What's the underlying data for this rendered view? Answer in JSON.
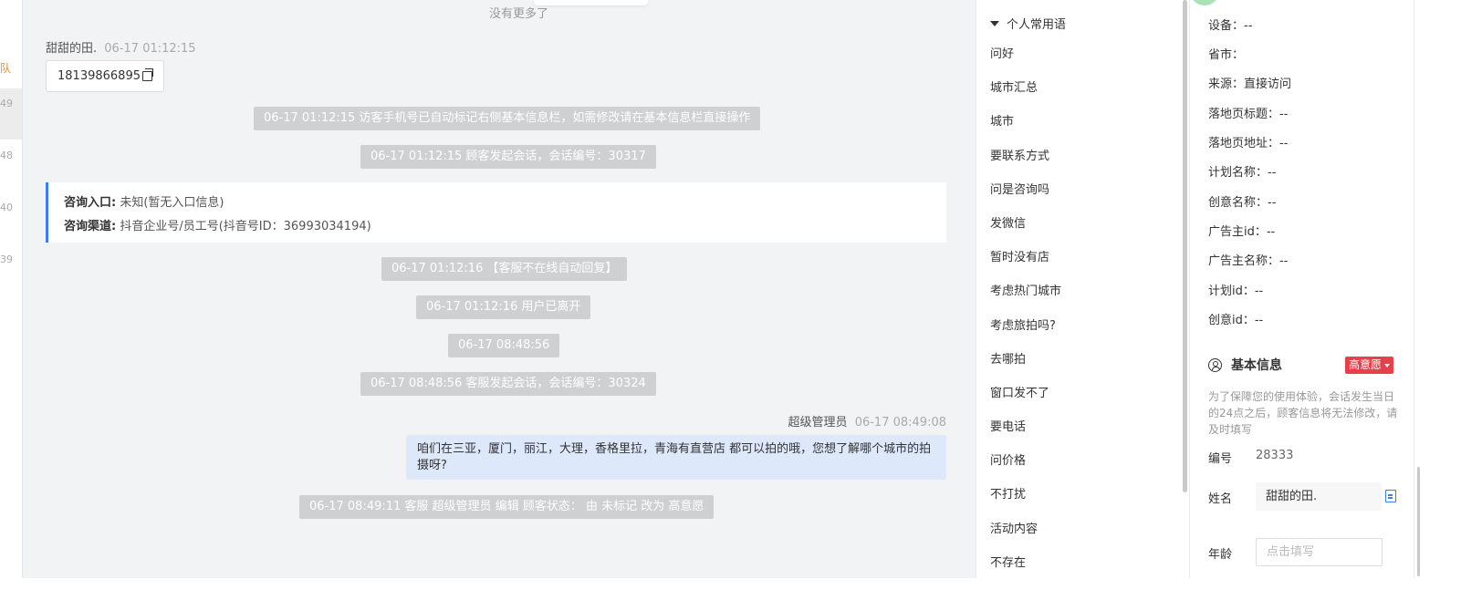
{
  "left_strip": {
    "items": [
      "队",
      "49",
      "48",
      "40",
      "39"
    ]
  },
  "chat": {
    "no_more": "没有更多了",
    "visitor_name": "甜甜的田.",
    "visitor_time": "06-17 01:12:15",
    "phone": "18139866895",
    "system_messages": [
      "06-17 01:12:15 访客手机号已自动标记右侧基本信息栏，如需修改请在基本信息栏直接操作",
      "06-17 01:12:15 顾客发起会话，会话编号：30317",
      "06-17 01:12:16 【客服不在线自动回复】",
      "06-17 01:12:16 用户已离开",
      "06-17 08:48:56",
      "06-17 08:48:56 客服发起会话，会话编号：30324",
      "06-17 08:49:11 客服 超级管理员 编辑 顾客状态： 由 未标记 改为 高意愿"
    ],
    "consult": {
      "entry_label": "咨询入口:",
      "entry_value": "未知(暂无入口信息)",
      "channel_label": "咨询渠道:",
      "channel_value": "抖音企业号/员工号(抖音号ID：36993034194)"
    },
    "admin_name": "超级管理员",
    "admin_time": "06-17 08:49:08",
    "admin_message": "咱们在三亚，厦门，丽江，大理，香格里拉，青海有直营店 都可以拍的哦，您想了解哪个城市的拍摄呀?"
  },
  "phrases": {
    "header": "个人常用语",
    "items": [
      "问好",
      "城市汇总",
      "城市",
      "要联系方式",
      "问是咨询吗",
      "发微信",
      "暂时没有店",
      "考虑热门城市",
      "考虑旅拍吗?",
      "去哪拍",
      "窗口发不了",
      "要电话",
      "问价格",
      "不打扰",
      "活动内容",
      "不存在"
    ]
  },
  "right_panel": {
    "rows": [
      "设备：--",
      "省市：",
      "来源：直接访问",
      "落地页标题：--",
      "落地页地址：--",
      "计划名称：--",
      "创意名称：--",
      "广告主id：--",
      "广告主名称：--",
      "计划id：--",
      "创意id：--"
    ],
    "section_title": "基本信息",
    "badge": "高意愿",
    "badge_color": "#e5404c",
    "notice": "为了保障您的使用体验，会话发生当日的24点之后，顾客信息将无法修改，请及时填写",
    "id_label": "编号",
    "id_value": "28333",
    "name_label": "姓名",
    "name_value": "甜甜的田.",
    "age_label": "年龄",
    "age_placeholder": "点击填写"
  },
  "colors": {
    "accent_blue": "#3a7ef0",
    "chat_bg": "#f2f3f5",
    "system_msg_bg": "#cfd0d2",
    "admin_bubble_bg": "#dde8fb"
  }
}
